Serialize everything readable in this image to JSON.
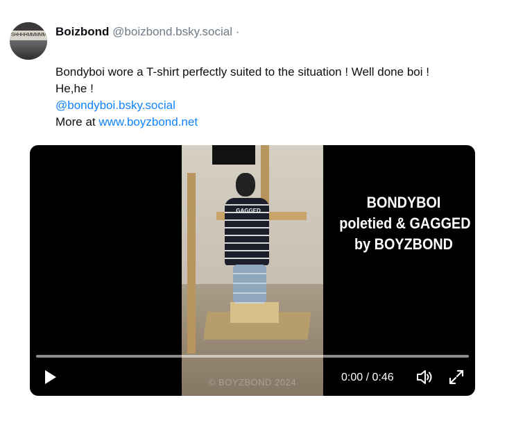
{
  "post": {
    "author": {
      "display_name": "Boizbond",
      "handle": "@boizbond.bsky.social",
      "separator": "·",
      "avatar_text": "SHHHHMMMMMPH",
      "avatar_icon": "user-avatar"
    },
    "text": {
      "line1": "Bondyboi  wore a T-shirt perfectly suited to the situation ! Well done boi !",
      "line2": "He,he !",
      "mention": "@bondyboi.bsky.social",
      "more_prefix": "More at ",
      "more_link": "www.boyzbond.net"
    }
  },
  "video": {
    "overlay_lines": [
      "BONDYBOI",
      "poletied & GAGGED",
      "by BOYZBOND"
    ],
    "frame_shirt_print": "GAGGED",
    "frame_watermark": "© BOYZBOND 2024",
    "progress_fraction": 0.0,
    "time_display": "0:00 / 0:46",
    "controls": {
      "play_icon": "play-icon",
      "volume_icon": "volume-icon",
      "fullscreen_icon": "fullscreen-expand-icon"
    }
  },
  "colors": {
    "link": "#1083fe",
    "handle": "#6f7a86",
    "video_bg": "#000000"
  }
}
